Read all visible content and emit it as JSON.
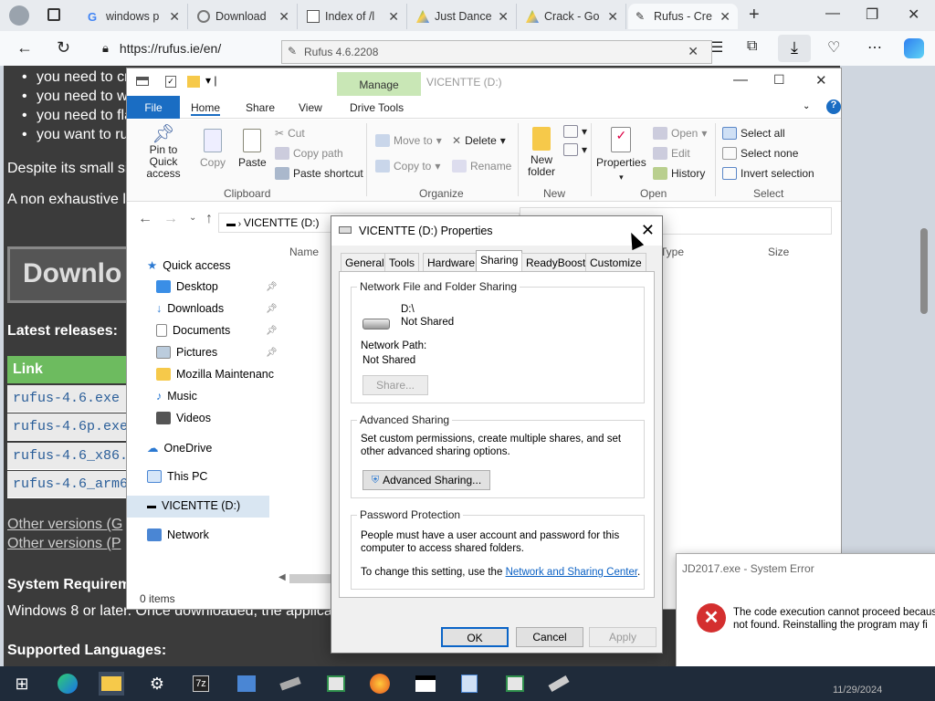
{
  "browser": {
    "tabs": [
      {
        "label": "windows p"
      },
      {
        "label": "Download"
      },
      {
        "label": "Index of /l"
      },
      {
        "label": "Just Dance"
      },
      {
        "label": "Crack - Go"
      },
      {
        "label": "Rufus - Cre"
      }
    ],
    "url": "https://rufus.ie/en/"
  },
  "web": {
    "bullets": [
      "you need to cr",
      "you need to w",
      "you need to fla",
      "you want to ru"
    ],
    "para1": "Despite its small si",
    "para2": "A non exhaustive l",
    "download_button": "Downlo",
    "latest_heading": "Latest releases:",
    "link_header": "Link",
    "files": [
      "rufus-4.6.exe",
      "rufus-4.6p.exe",
      "rufus-4.6_x86.",
      "rufus-4.6_arm6"
    ],
    "other1": "Other versions (G",
    "other2": "Other versions (P",
    "sysreq": "System Requirem",
    "windows_text": "Windows 8 or later. Once downloaded, the applica",
    "languages": "Supported Languages:"
  },
  "rufus_window": {
    "title": "Rufus 4.6.2208"
  },
  "explorer": {
    "title": "VICENTTE (D:)",
    "manage": "Manage",
    "tabs": {
      "file": "File",
      "home": "Home",
      "share": "Share",
      "view": "View",
      "drive_tools": "Drive Tools"
    },
    "clipboard": {
      "pin": "Pin to Quick access",
      "copy": "Copy",
      "paste": "Paste",
      "cut": "Cut",
      "copy_path": "Copy path",
      "paste_shortcut": "Paste shortcut",
      "group": "Clipboard"
    },
    "organize": {
      "move_to": "Move to",
      "copy_to": "Copy to",
      "delete": "Delete",
      "rename": "Rename",
      "group": "Organize"
    },
    "new": {
      "new_folder": "New folder",
      "group": "New"
    },
    "open": {
      "properties": "Properties",
      "open": "Open",
      "edit": "Edit",
      "history": "History",
      "group": "Open"
    },
    "select": {
      "select_all": "Select all",
      "select_none": "Select none",
      "invert": "Invert selection",
      "group": "Select"
    },
    "breadcrumb": "VICENTTE (D:)",
    "columns": {
      "name": "Name",
      "type": "Type",
      "size": "Size"
    },
    "nav": {
      "quick_access": "Quick access",
      "desktop": "Desktop",
      "downloads": "Downloads",
      "documents": "Documents",
      "pictures": "Pictures",
      "mozilla": "Mozilla Maintenanc",
      "music": "Music",
      "videos": "Videos",
      "onedrive": "OneDrive",
      "this_pc": "This PC",
      "drive": "VICENTTE (D:)",
      "network": "Network"
    },
    "status": "0 items"
  },
  "properties": {
    "title": "VICENTTE (D:) Properties",
    "tabs": [
      "General",
      "Tools",
      "Hardware",
      "Sharing",
      "ReadyBoost",
      "Customize"
    ],
    "nfs_legend": "Network File and Folder Sharing",
    "drive_path": "D:\\",
    "drive_state": "Not Shared",
    "network_path_label": "Network Path:",
    "network_path_value": "Not Shared",
    "share_button": "Share...",
    "adv_legend": "Advanced Sharing",
    "adv_text": "Set custom permissions, create multiple shares, and set other advanced sharing options.",
    "adv_button": "Advanced Sharing...",
    "pw_legend": "Password Protection",
    "pw_text": "People must have a user account and password for this computer to access shared folders.",
    "pw_text2": "To change this setting, use the",
    "pw_link": "Network and Sharing Center",
    "pw_end": ".",
    "ok": "OK",
    "cancel": "Cancel",
    "apply": "Apply"
  },
  "error": {
    "title": "JD2017.exe - System Error",
    "line1": "The code execution cannot proceed becaus",
    "line2": "not found. Reinstalling the program may fi"
  },
  "taskbar": {
    "clock": "11/29/2024"
  }
}
